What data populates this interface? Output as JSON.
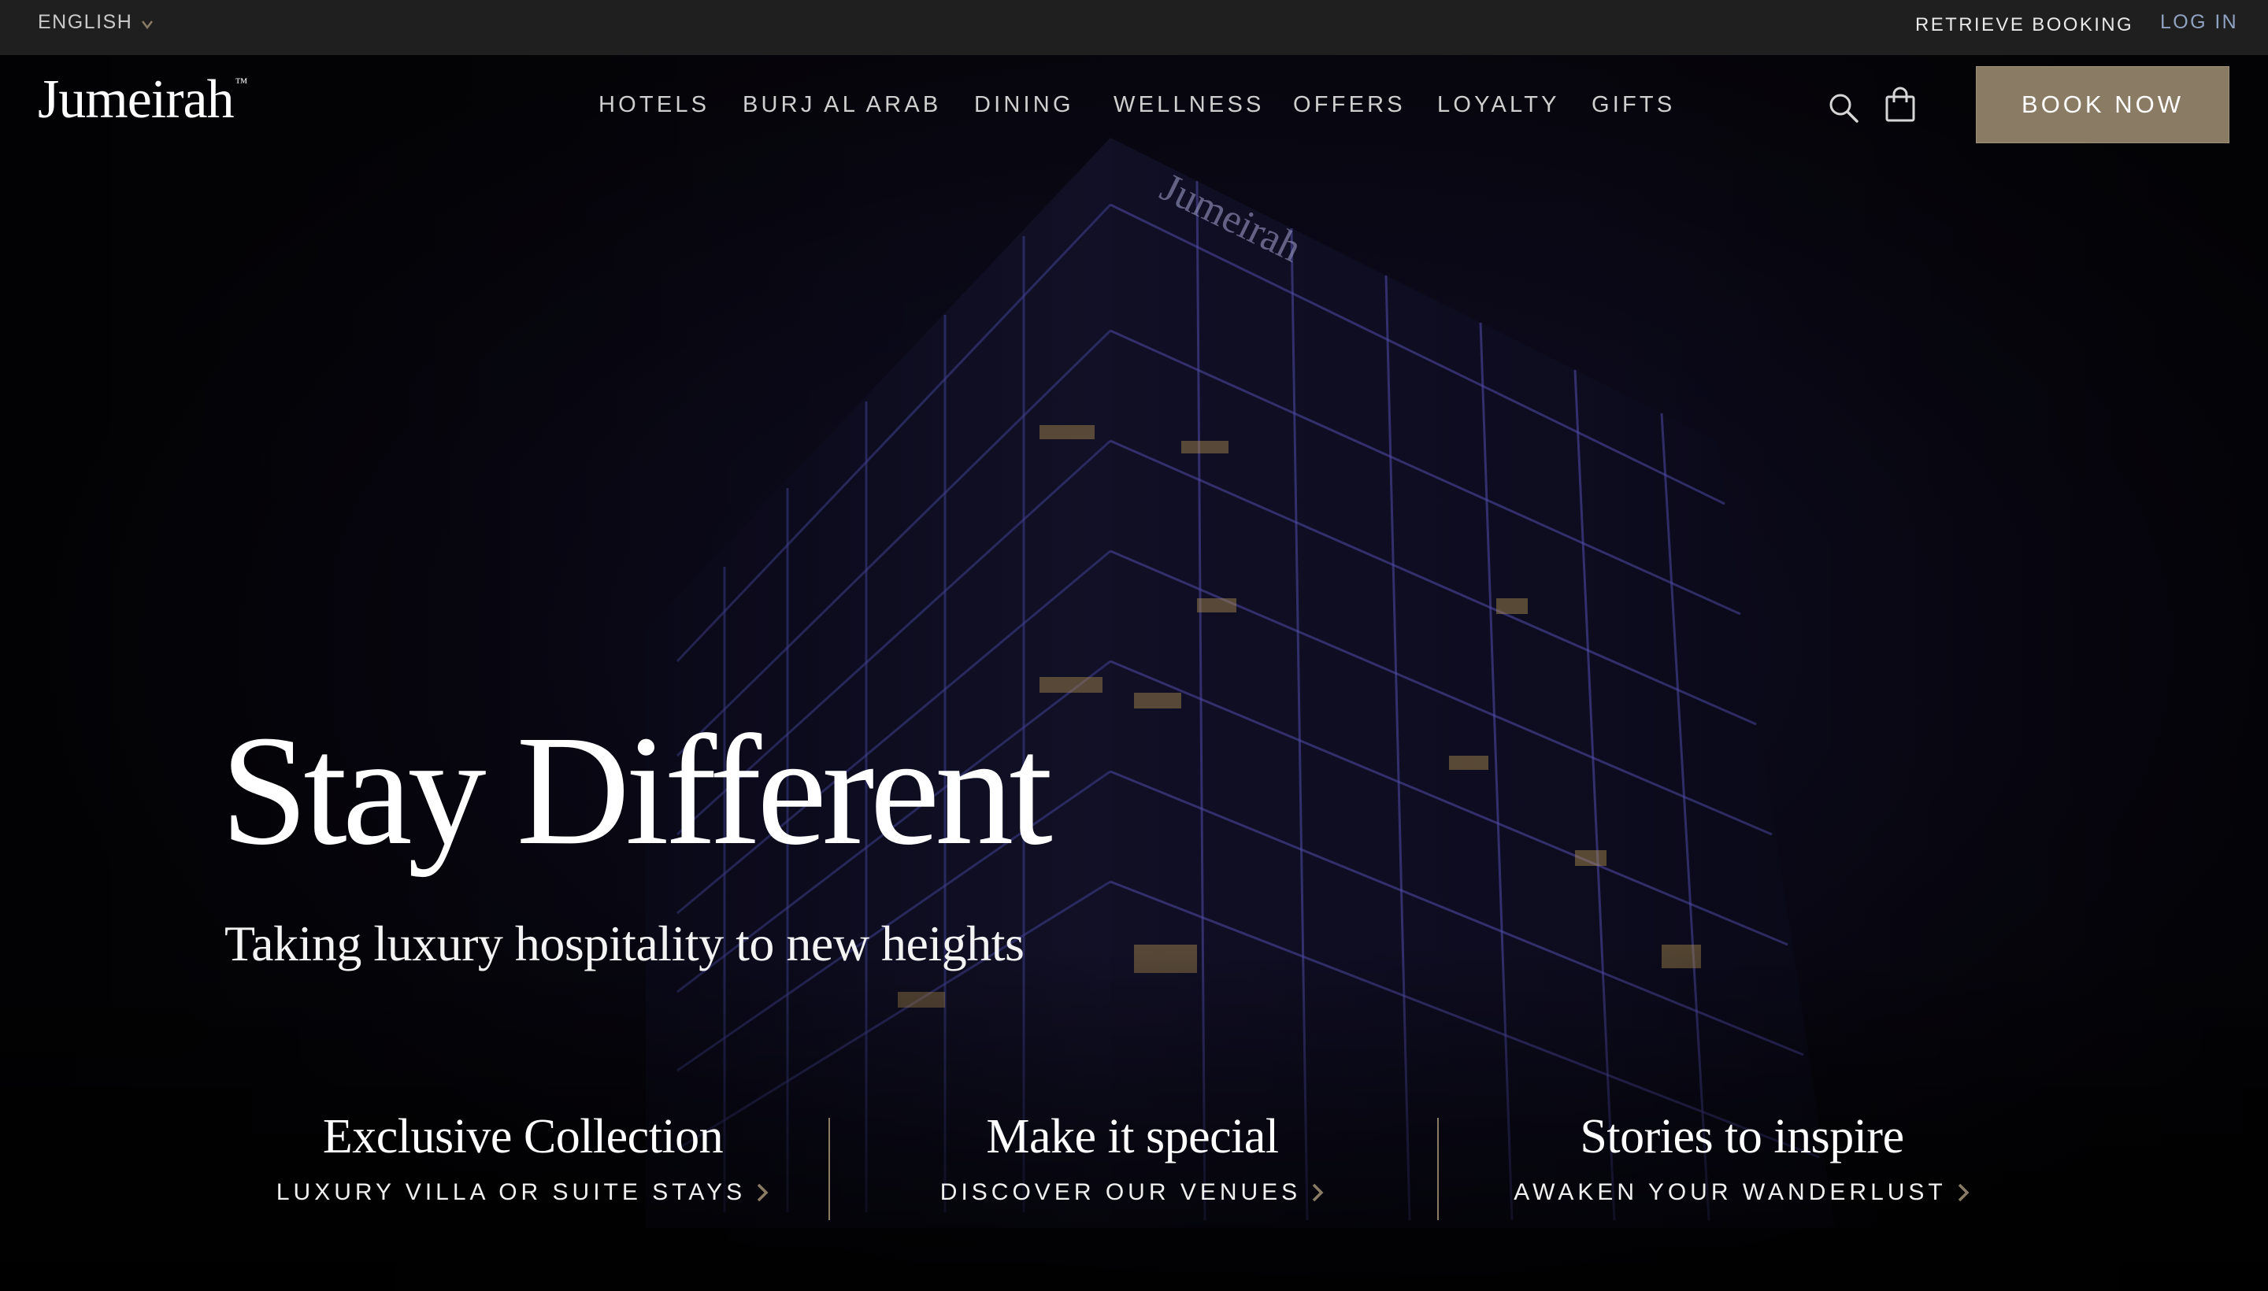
{
  "topbar": {
    "language": "ENGLISH",
    "retrieve_booking": "RETRIEVE BOOKING",
    "login": "LOG IN"
  },
  "header": {
    "logo_text": "Jumeirah",
    "logo_mark": "™",
    "nav": [
      {
        "label": "HOTELS"
      },
      {
        "label": "BURJ AL ARAB"
      },
      {
        "label": "DINING"
      },
      {
        "label": "WELLNESS"
      },
      {
        "label": "OFFERS"
      },
      {
        "label": "LOYALTY"
      },
      {
        "label": "GIFTS"
      }
    ],
    "search_icon": "search-icon",
    "cart_icon": "shopping-bag-icon",
    "book_now": "BOOK NOW"
  },
  "hero": {
    "title": "Stay Different",
    "subtitle": "Taking luxury hospitality to new heights"
  },
  "features": [
    {
      "title": "Exclusive Collection",
      "link": "LUXURY VILLA OR SUITE STAYS"
    },
    {
      "title": "Make it special",
      "link": "DISCOVER OUR VENUES"
    },
    {
      "title": "Stories to inspire",
      "link": "AWAKEN YOUR WANDERLUST"
    }
  ],
  "colors": {
    "accent_gold": "#8a7c64",
    "topbar_bg": "#1f1f20",
    "login_blue": "#8fa3c1",
    "background": "#07050a"
  }
}
